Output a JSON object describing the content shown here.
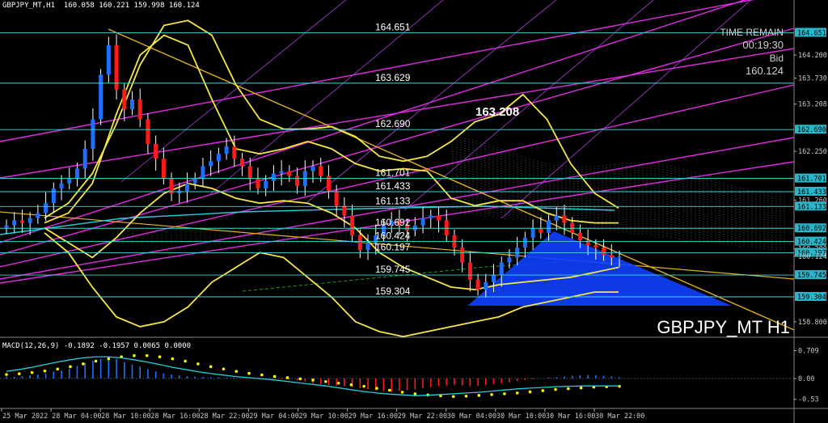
{
  "header": {
    "main": "GBPJPY_MT,H1  160.058 160.221 159.998 160.124",
    "macd": "MACD(12,26,9) -0.1892 -0.1957 0.0065 0.0000"
  },
  "info": {
    "timer_label": "TIME REMAIN",
    "timer_value": "00:19:30",
    "bid_label": "Bid",
    "bid_value": "160.124"
  },
  "watermark": "GBPJPY_MT H1",
  "marker": "163.208",
  "colors": {
    "background": "#000000",
    "bull": "#1e6fff",
    "bear": "#ff1a1a",
    "band": "#f5e74a",
    "level": "#3fd9d9",
    "channel": "#e32be3",
    "trend": "#e0b020",
    "cloud": "#1040ff",
    "signal": "#ffff00"
  },
  "chart_data": [
    {
      "type": "candlestick",
      "title": "GBPJPY_MT H1",
      "ylim": [
        158.6,
        165.15
      ],
      "y_ticks": [
        "164.651",
        "164.200",
        "163.730",
        "163.208",
        "162.690",
        "162.250",
        "161.701",
        "161.433",
        "161.260",
        "161.133",
        "160.692",
        "160.424",
        "160.280",
        "160.197",
        "160.124",
        "159.745",
        "159.304",
        "158.800"
      ],
      "y_tick_values": [
        164.651,
        164.2,
        163.73,
        163.208,
        162.69,
        162.25,
        161.701,
        161.433,
        161.26,
        161.133,
        160.692,
        160.424,
        160.28,
        160.197,
        160.124,
        159.745,
        159.304,
        158.8
      ],
      "x_ticks": [
        "25 Mar 2022",
        "28 Mar 04:00",
        "28 Mar 10:00",
        "28 Mar 16:00",
        "28 Mar 22:00",
        "29 Mar 04:00",
        "29 Mar 10:00",
        "29 Mar 16:00",
        "29 Mar 22:00",
        "30 Mar 04:00",
        "30 Mar 10:00",
        "30 Mar 16:00",
        "30 Mar 22:00"
      ],
      "levels": [
        {
          "label": "164.651",
          "value": 164.651
        },
        {
          "label": "163.629",
          "value": 163.629
        },
        {
          "label": "162.690",
          "value": 162.69
        },
        {
          "label": "161.701",
          "value": 161.701
        },
        {
          "label": "161.433",
          "value": 161.433
        },
        {
          "label": "161.133",
          "value": 161.133
        },
        {
          "label": "160.692",
          "value": 160.692
        },
        {
          "label": "160.424",
          "value": 160.424
        },
        {
          "label": "160.197",
          "value": 160.197
        },
        {
          "label": "159.745",
          "value": 159.745
        },
        {
          "label": "159.304",
          "value": 159.304
        }
      ],
      "close": [
        160.75,
        160.85,
        160.8,
        160.9,
        161.0,
        161.2,
        161.5,
        161.6,
        161.7,
        161.9,
        162.3,
        162.9,
        163.8,
        164.4,
        163.5,
        163.1,
        163.3,
        162.9,
        162.4,
        162.1,
        161.7,
        161.4,
        161.45,
        161.6,
        161.7,
        161.95,
        162.05,
        162.2,
        162.35,
        162.1,
        161.95,
        161.7,
        161.5,
        161.65,
        161.8,
        161.85,
        161.75,
        161.55,
        161.85,
        161.95,
        161.75,
        161.45,
        161.15,
        160.95,
        160.55,
        160.25,
        160.4,
        160.55,
        160.75,
        160.85,
        160.75,
        160.65,
        160.75,
        160.9,
        160.95,
        160.85,
        160.55,
        160.3,
        160.0,
        159.65,
        159.45,
        159.6,
        159.75,
        160.0,
        160.1,
        160.3,
        160.5,
        160.7,
        160.6,
        160.85,
        160.95,
        160.8,
        160.6,
        160.45,
        160.35,
        160.3,
        160.15,
        160.1,
        160.12
      ],
      "volatility_bands": {
        "outer_upper": [
          160.9,
          161.2,
          161.8,
          162.8,
          164.0,
          164.8,
          164.9,
          164.6,
          163.6,
          162.9,
          162.7,
          162.7,
          162.75,
          162.55,
          162.15,
          162.05,
          162.15,
          162.45,
          162.85,
          163.0,
          163.4,
          162.9,
          162.0,
          161.4,
          161.1
        ],
        "outer_lower": [
          160.6,
          160.2,
          159.5,
          158.9,
          158.7,
          158.8,
          159.1,
          159.6,
          159.9,
          160.2,
          160.1,
          159.7,
          159.3,
          158.8,
          158.6,
          158.5,
          158.6,
          158.7,
          158.8,
          158.9,
          159.1,
          159.2,
          159.3,
          159.4,
          159.4
        ],
        "inner_upper": [
          160.8,
          161.0,
          161.6,
          163.0,
          164.2,
          164.6,
          164.4,
          163.3,
          162.3,
          162.2,
          162.3,
          162.45,
          162.3,
          162.0,
          161.85,
          161.9,
          161.85,
          161.3,
          161.15,
          161.25,
          161.25,
          161.0,
          160.85,
          160.8,
          160.8
        ],
        "inner_lower": [
          160.7,
          160.4,
          160.1,
          160.5,
          161.0,
          161.4,
          161.6,
          161.5,
          161.3,
          161.2,
          161.25,
          161.2,
          161.0,
          160.7,
          160.2,
          159.9,
          159.7,
          159.5,
          159.45,
          159.55,
          159.6,
          159.65,
          159.7,
          159.8,
          159.9
        ]
      }
    },
    {
      "type": "bar",
      "title": "MACD(12,26,9)",
      "ylim": [
        -0.66,
        0.78
      ],
      "y_ticks": [
        "0.709",
        "0.00",
        "-0.53"
      ],
      "y_tick_values": [
        0.709,
        0.0,
        -0.53
      ],
      "histogram": [
        0.05,
        0.04,
        0.06,
        0.08,
        0.1,
        0.13,
        0.17,
        0.2,
        0.25,
        0.32,
        0.4,
        0.45,
        0.5,
        0.55,
        0.5,
        0.42,
        0.36,
        0.3,
        0.24,
        0.18,
        0.13,
        0.1,
        0.08,
        0.06,
        0.05,
        0.04,
        0.03,
        0.03,
        0.02,
        0.02,
        0.01,
        0.01,
        0.0,
        -0.01,
        -0.01,
        -0.02,
        -0.03,
        -0.05,
        -0.08,
        -0.12,
        -0.15,
        -0.17,
        -0.18,
        -0.2,
        -0.22,
        -0.25,
        -0.27,
        -0.3,
        -0.32,
        -0.34,
        -0.32,
        -0.3,
        -0.28,
        -0.25,
        -0.22,
        -0.2,
        -0.18,
        -0.17,
        -0.18,
        -0.2,
        -0.19,
        -0.17,
        -0.15,
        -0.12,
        -0.1,
        -0.07,
        -0.04,
        -0.02,
        0.0,
        0.02,
        0.03,
        0.05,
        0.07,
        0.08,
        0.09,
        0.08,
        0.07,
        0.05,
        0.03
      ],
      "signal": [
        0.1,
        0.12,
        0.15,
        0.19,
        0.24,
        0.3,
        0.37,
        0.44,
        0.5,
        0.55,
        0.58,
        0.58,
        0.55,
        0.5,
        0.44,
        0.37,
        0.3,
        0.24,
        0.18,
        0.13,
        0.09,
        0.05,
        0.02,
        -0.01,
        -0.04,
        -0.08,
        -0.12,
        -0.16,
        -0.2,
        -0.25,
        -0.3,
        -0.35,
        -0.39,
        -0.42,
        -0.44,
        -0.46,
        -0.45,
        -0.43,
        -0.41,
        -0.39,
        -0.37,
        -0.34,
        -0.31,
        -0.28,
        -0.26,
        -0.24,
        -0.22,
        -0.21,
        -0.2
      ]
    }
  ]
}
